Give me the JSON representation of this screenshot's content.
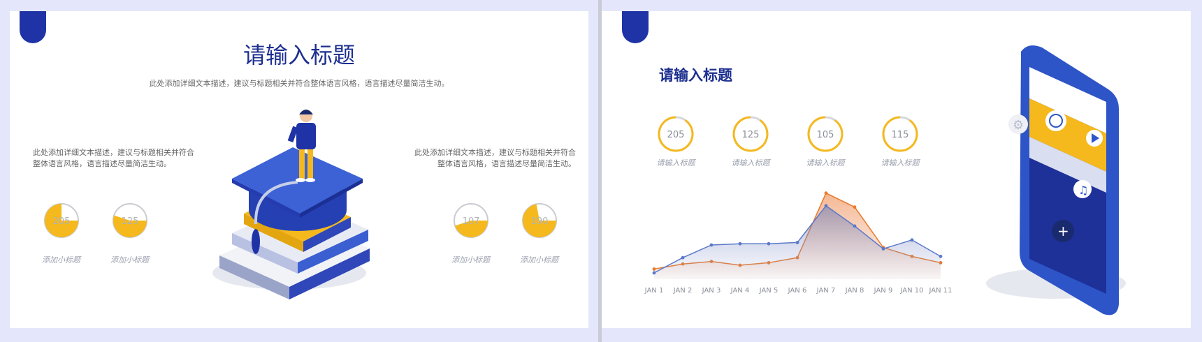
{
  "left_slide": {
    "title": "请输入标题",
    "subtitle": "此处添加详细文本描述，建议与标题相关并符合整体语言风格，语言描述尽量简洁生动。",
    "left_text": [
      "此处添加详细文本描述，建议与标题相关并符合",
      "整体语言风格，语言描述尽量简洁生动。"
    ],
    "right_text": [
      "此处添加详细文本描述，建议与标题相关并符合",
      "整体语言风格，语言描述尽量简洁生动。"
    ],
    "pies": [
      {
        "value": "205",
        "label": "添加小标题",
        "fraction": 0.75
      },
      {
        "value": "125",
        "label": "添加小标题",
        "fraction": 0.55
      },
      {
        "value": "107",
        "label": "添加小标题",
        "fraction": 0.45
      },
      {
        "value": "190",
        "label": "添加小标题",
        "fraction": 0.72
      }
    ]
  },
  "right_slide": {
    "title": "请输入标题",
    "rings": [
      {
        "value": "205",
        "label": "请输入标题"
      },
      {
        "value": "125",
        "label": "请输入标题"
      },
      {
        "value": "105",
        "label": "请输入标题"
      },
      {
        "value": "115",
        "label": "请输入标题"
      }
    ]
  },
  "chart_data": {
    "type": "area",
    "categories": [
      "JAN 1",
      "JAN 2",
      "JAN 3",
      "JAN 4",
      "JAN 5",
      "JAN 6",
      "JAN 7",
      "JAN 8",
      "JAN 9",
      "JAN 10",
      "JAN 11"
    ],
    "series": [
      {
        "values": [
          8,
          12,
          14,
          11,
          13,
          17,
          68,
          57,
          25,
          18,
          13
        ],
        "color": "#e87a2e"
      },
      {
        "values": [
          5,
          17,
          27,
          28,
          28,
          29,
          58,
          42,
          24,
          31,
          18
        ],
        "color": "#5b79c9"
      }
    ],
    "ylim": [
      0,
      75
    ],
    "grid": false
  },
  "colors": {
    "brand": "#1f33a6",
    "accent": "#f5b91e",
    "orange": "#e87a2e",
    "blue_line": "#5b79c9"
  }
}
